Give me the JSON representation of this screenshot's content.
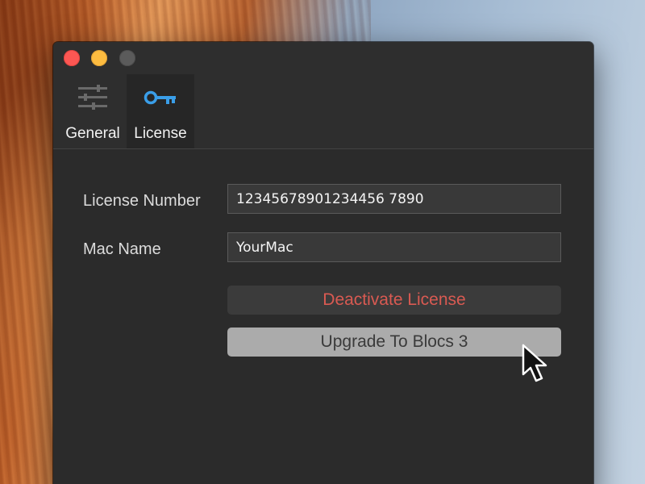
{
  "window": {
    "tabs": [
      {
        "id": "general",
        "label": "General",
        "icon": "sliders-icon",
        "selected": false
      },
      {
        "id": "license",
        "label": "License",
        "icon": "key-icon",
        "selected": true
      }
    ]
  },
  "license_form": {
    "license_number_label": "License Number",
    "license_number_value": "12345678901234456 7890",
    "mac_name_label": "Mac Name",
    "mac_name_value": "YourMac"
  },
  "actions": {
    "deactivate_label": "Deactivate License",
    "upgrade_label": "Upgrade To Blocs 3"
  },
  "colors": {
    "accent_key": "#3a9ee8",
    "deactivate_text": "#d95a52",
    "close": "#fc5753",
    "minimize": "#fdbc40",
    "zoom_disabled": "#5b5b5b"
  }
}
